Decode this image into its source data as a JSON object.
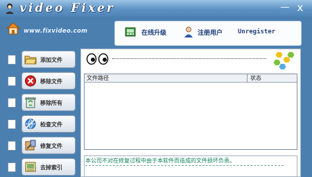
{
  "window": {
    "title": "video Fixer",
    "minimize_glyph": "—",
    "close_glyph": "x"
  },
  "header": {
    "website": "www.fixvideo.com",
    "online_update": "在线升级",
    "register_user": "注册用户",
    "status": "Unregister"
  },
  "sidebar": {
    "buttons": [
      {
        "label": "添加文件",
        "icon": "folder-open-icon"
      },
      {
        "label": "移除文件",
        "icon": "remove-x-icon"
      },
      {
        "label": "移除所有",
        "icon": "recycle-bin-icon"
      },
      {
        "label": "检查文件",
        "icon": "check-globe-icon"
      },
      {
        "label": "修复文件",
        "icon": "repair-tools-icon"
      },
      {
        "label": "去掉索引",
        "icon": "remove-index-icon"
      }
    ]
  },
  "table": {
    "columns": [
      "文件路径",
      "状态"
    ],
    "rows": []
  },
  "log": {
    "disclaimer": "本公司不对在修复过程中由于本软件而造成的文件损坏负责。"
  },
  "colors": {
    "window_bg": "#4a7fb0",
    "disclaimer_text": "#0f7f5a",
    "header_link": "#1c3d7a"
  }
}
